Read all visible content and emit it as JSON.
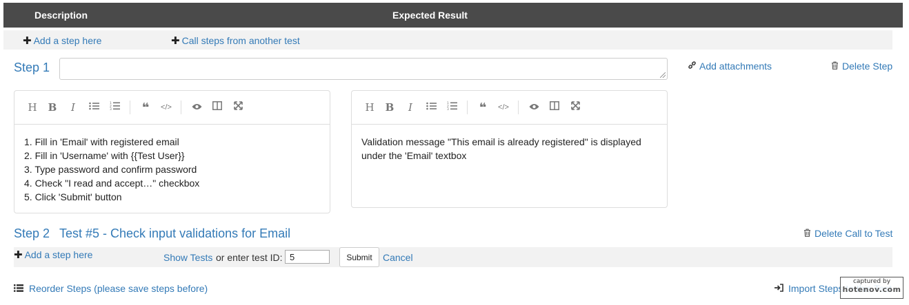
{
  "header": {
    "description": "Description",
    "expected_result": "Expected Result"
  },
  "top_actions": {
    "add_step": "Add a step here",
    "call_steps": "Call steps from another test"
  },
  "step1": {
    "label": "Step 1",
    "title_value": "",
    "add_attachments": "Add attachments",
    "delete_step": "Delete Step",
    "description_lines": [
      "1. Fill in 'Email' with registered email",
      "2. Fill in 'Username' with {{Test User}}",
      "3. Type password and confirm password",
      "4. Check \"I read and accept…\" checkbox",
      "5. Click 'Submit' button"
    ],
    "expected_lines": [
      "Validation message \"This email is already registered\" is displayed",
      "under the 'Email' textbox"
    ]
  },
  "toolbar_icons": [
    "heading-icon",
    "bold-icon",
    "italic-icon",
    "unordered-list-icon",
    "ordered-list-icon",
    "quote-icon",
    "code-icon",
    "preview-icon",
    "side-by-side-icon",
    "fullscreen-icon"
  ],
  "step2": {
    "label": "Step 2",
    "call_title": "Test #5 - Check input validations for Email",
    "delete_call": "Delete Call to Test"
  },
  "bottom_form": {
    "add_step": "Add a step here",
    "show_tests": "Show Tests",
    "or_enter": "or enter test ID:",
    "test_id_value": "5",
    "submit": "Submit",
    "cancel": "Cancel"
  },
  "footer": {
    "reorder": "Reorder Steps (please save steps before)",
    "import": "Import Steps to this Test"
  },
  "watermark": {
    "line1": "captured by",
    "line2": "hotenov.com"
  },
  "colors": {
    "header_bg": "#4a4a4a",
    "link": "#337ab7",
    "strip_bg": "#f2f2f2"
  }
}
